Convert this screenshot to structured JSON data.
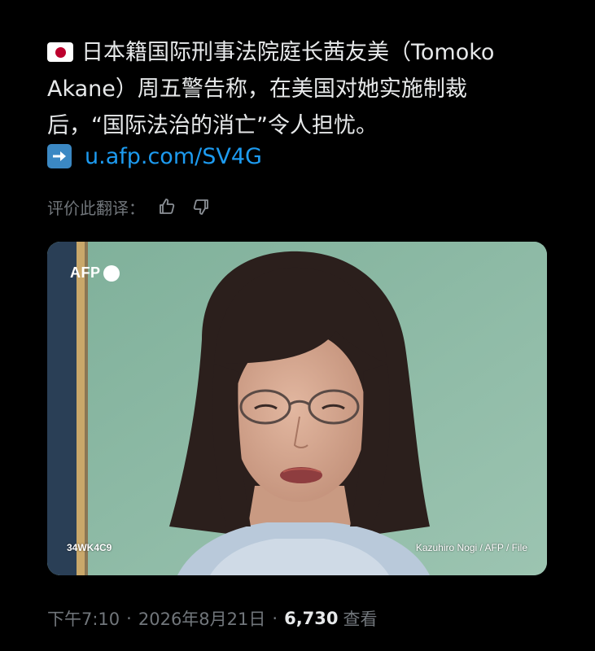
{
  "post": {
    "flag_icon": "japan-flag-icon",
    "text_lines": [
      "日本籍国际刑事法院庭长茜友美（Tomoko",
      "Akane）周五警告称，在美国对她实施制裁",
      "后，“国际法治的消亡”令人担忧。"
    ],
    "link_icon": "right-arrow-icon",
    "link_text": "u.afp.com/SV4G"
  },
  "translation_rating": {
    "label": "评价此翻译：",
    "thumbs_up_icon": "thumbs-up-icon",
    "thumbs_down_icon": "thumbs-down-icon"
  },
  "media": {
    "agency_logo": "AFP",
    "image_code": "34WK4C9",
    "image_credit": "Kazuhiro Nogi / AFP / File"
  },
  "meta": {
    "time": "下午7:10",
    "date": "2026年8月21日",
    "separator": "·",
    "views_count": "6,730",
    "views_label": "查看"
  },
  "colors": {
    "background": "#000000",
    "text": "#e7e9ea",
    "secondary_text": "#71767b",
    "link": "#1d9bf0",
    "arrow_box": "#3b88c3",
    "flag_red": "#bc002d"
  }
}
